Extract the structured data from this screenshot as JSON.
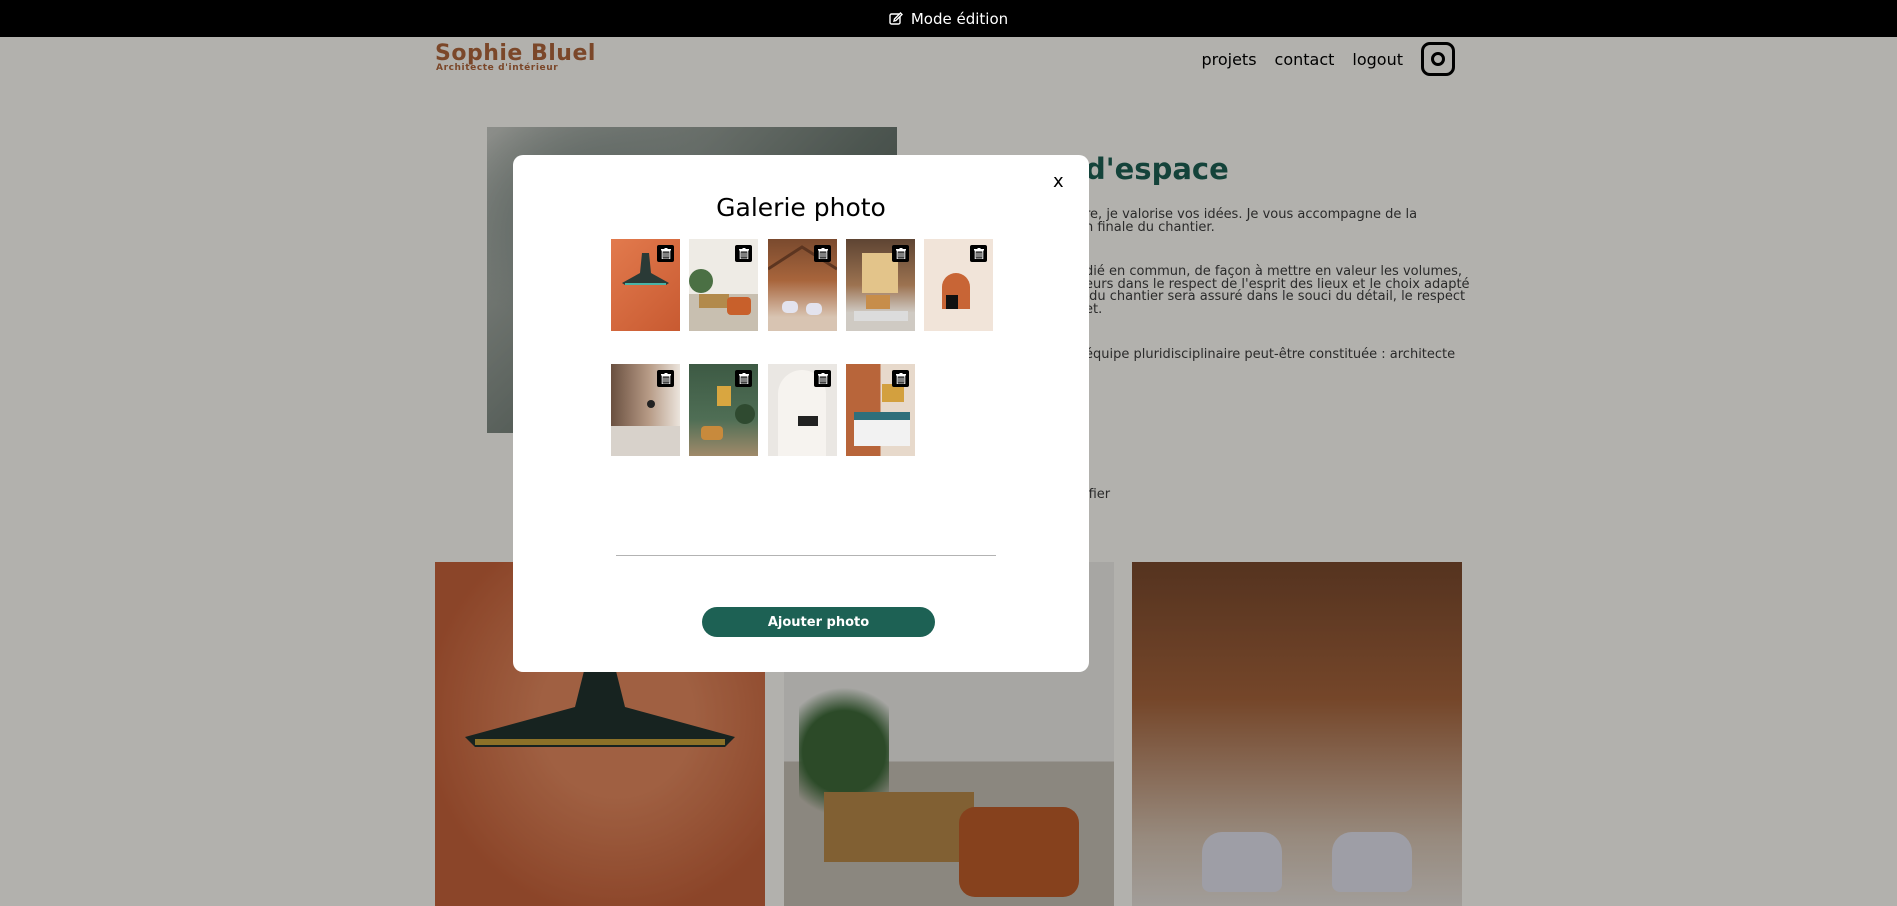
{
  "edit_bar": {
    "label": "Mode édition",
    "icon": "pen-square-icon"
  },
  "header": {
    "logo_title": "Sophie Bluel",
    "logo_subtitle": "Architecte d'intérieur",
    "nav": [
      "projets",
      "contact",
      "logout"
    ],
    "instagram_icon": "instagram-icon"
  },
  "intro": {
    "title": "d'espace",
    "paragraphs": [
      "re, je valorise vos idées. Je vous accompagne de la\nn finale du chantier.",
      "dié en commun, de façon à mettre en valeur les volumes,\neurs dans le respect de l'esprit des lieux et le choix adapté\n du chantier sera assuré dans le souci du détail, le respect\net.",
      "équipe pluridisciplinaire peut-être constituée : architecte\n"
    ],
    "fragment": "ifier"
  },
  "modal": {
    "title": "Galerie photo",
    "close_label": "x",
    "add_button": "Ajouter photo",
    "thumbnail_count": 9,
    "delete_icon": "trash-icon"
  },
  "colors": {
    "accent": "#1d6154",
    "brand": "#b1663c",
    "edit_bar": "#000000"
  }
}
